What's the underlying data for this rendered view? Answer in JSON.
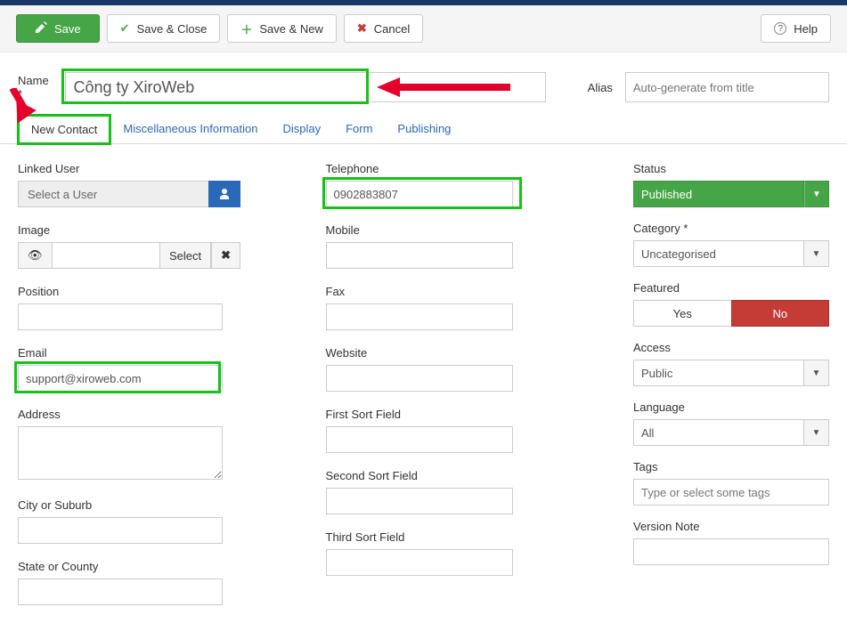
{
  "toolbar": {
    "save": "Save",
    "save_close": "Save & Close",
    "save_new": "Save & New",
    "cancel": "Cancel",
    "help": "Help"
  },
  "header": {
    "name_label": "Name *",
    "name_value": "Công ty XiroWeb",
    "alias_label": "Alias",
    "alias_placeholder": "Auto-generate from title"
  },
  "tabs": {
    "new_contact": "New Contact",
    "misc": "Miscellaneous Information",
    "display": "Display",
    "form": "Form",
    "publishing": "Publishing"
  },
  "left": {
    "linked_user": "Linked User",
    "select_user": "Select a User",
    "image": "Image",
    "select": "Select",
    "position": "Position",
    "email": "Email",
    "email_value": "support@xiroweb.com",
    "address": "Address",
    "city": "City or Suburb",
    "state": "State or County"
  },
  "mid": {
    "telephone": "Telephone",
    "telephone_value": "0902883807",
    "mobile": "Mobile",
    "fax": "Fax",
    "website": "Website",
    "first_sort": "First Sort Field",
    "second_sort": "Second Sort Field",
    "third_sort": "Third Sort Field"
  },
  "side": {
    "status": "Status",
    "status_value": "Published",
    "category": "Category *",
    "category_value": "Uncategorised",
    "featured": "Featured",
    "yes": "Yes",
    "no": "No",
    "access": "Access",
    "access_value": "Public",
    "language": "Language",
    "language_value": "All",
    "tags": "Tags",
    "tags_placeholder": "Type or select some tags",
    "version_note": "Version Note"
  }
}
